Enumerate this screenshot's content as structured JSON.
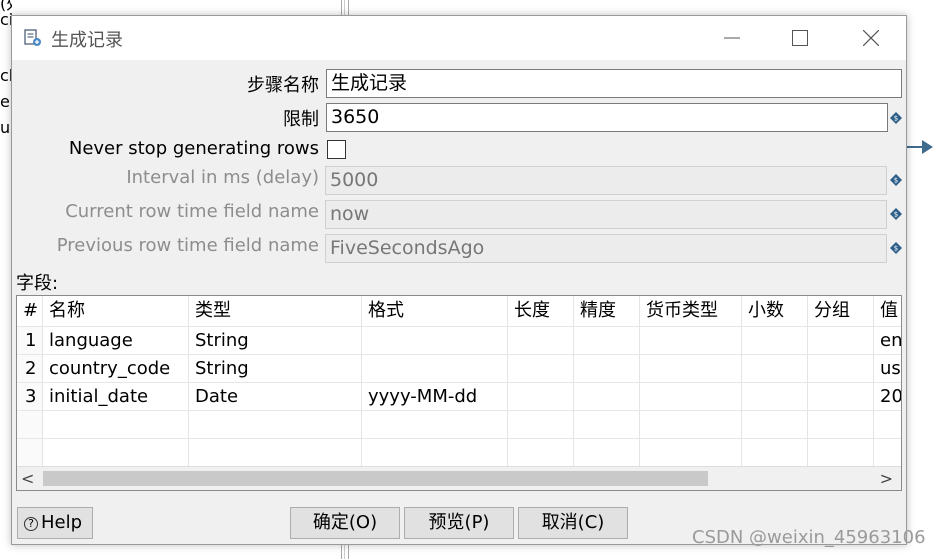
{
  "background": {
    "left_text": [
      "(处理)",
      "ci",
      "ch",
      "e",
      "us"
    ],
    "watermark": "CSDN @weixin_45963106"
  },
  "dialog": {
    "title": "生成记录",
    "title_icon": "generate-rows-icon",
    "controls": {
      "minimize": "minimize-icon",
      "maximize": "maximize-icon",
      "close": "close-icon"
    }
  },
  "form": {
    "step_name_label": "步骤名称",
    "step_name_value": "生成记录",
    "limit_label": "限制",
    "limit_value": "3650",
    "never_stop_label": "Never stop generating rows",
    "never_stop_checked": false,
    "interval_label": "Interval in ms (delay)",
    "interval_value": "5000",
    "current_row_label": "Current row time field name",
    "current_row_value": "now",
    "previous_row_label": "Previous row time field name",
    "previous_row_value": "FiveSecondsAgo",
    "variable_icon": "variable-diamond-icon"
  },
  "fields": {
    "label": "字段:",
    "columns": [
      "#",
      "名称",
      "类型",
      "格式",
      "长度",
      "精度",
      "货币类型",
      "小数",
      "分组",
      "值"
    ],
    "rows": [
      [
        "1",
        "language",
        "String",
        "",
        "",
        "",
        "",
        "",
        "",
        "en"
      ],
      [
        "2",
        "country_code",
        "String",
        "",
        "",
        "",
        "",
        "",
        "",
        "us"
      ],
      [
        "3",
        "initial_date",
        "Date",
        "yyyy-MM-dd",
        "",
        "",
        "",
        "",
        "",
        "20"
      ],
      [
        "",
        "",
        "",
        "",
        "",
        "",
        "",
        "",
        "",
        ""
      ],
      [
        "",
        "",
        "",
        "",
        "",
        "",
        "",
        "",
        "",
        ""
      ]
    ],
    "scroll_left": "<",
    "scroll_right": ">"
  },
  "buttons": {
    "help": "Help",
    "ok": "确定(O)",
    "preview": "预览(P)",
    "cancel": "取消(C)"
  },
  "colors": {
    "dialog_bg": "#f0f0f0",
    "hop_arrow": "#3f6b8f",
    "disabled_text": "#8d8d8d"
  }
}
